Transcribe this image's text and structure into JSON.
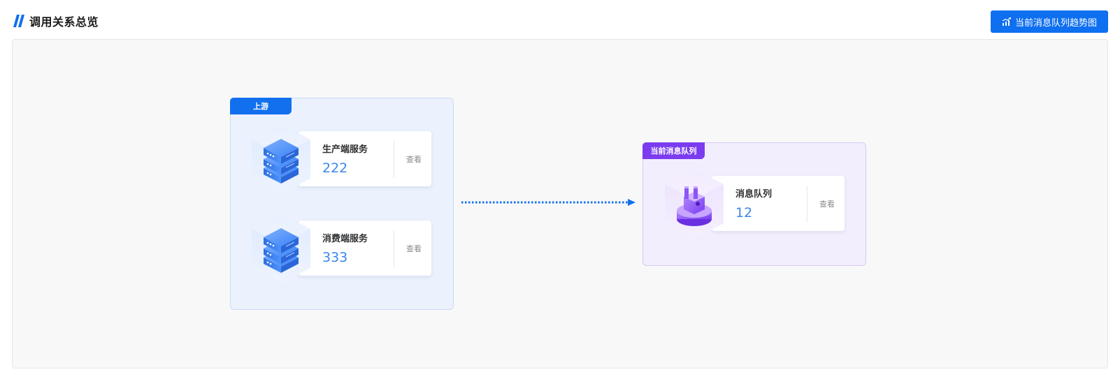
{
  "header": {
    "title": "调用关系总览",
    "trend_button_label": "当前消息队列趋势图"
  },
  "upstream": {
    "tag": "上游",
    "services": [
      {
        "name": "生产端服务",
        "count": "222",
        "view_label": "查看"
      },
      {
        "name": "消费端服务",
        "count": "333",
        "view_label": "查看"
      }
    ]
  },
  "queue": {
    "tag": "当前消息队列",
    "name": "消息队列",
    "count": "12",
    "view_label": "查看"
  },
  "colors": {
    "primary": "#0e6ff0",
    "upstream_bg": "#ebf2fd",
    "queue_accent": "#7b3cf0",
    "queue_bg": "#f3eefd",
    "count_color": "#3a86ee"
  },
  "icons": {
    "title": "double-slash-icon",
    "trend_button": "trend-chart-icon",
    "service": "server-stack-icon",
    "queue": "message-queue-icon",
    "flow": "dotted-arrow-icon"
  }
}
